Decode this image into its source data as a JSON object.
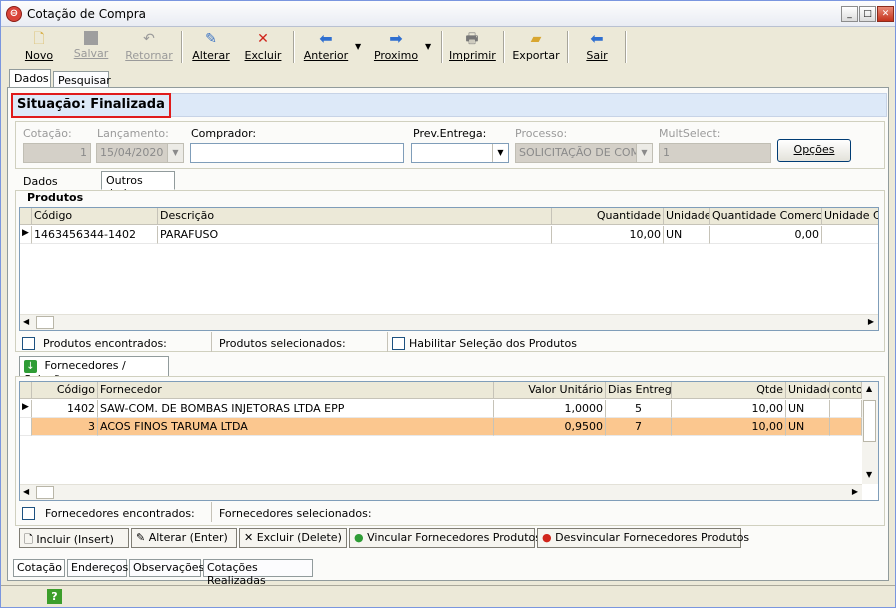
{
  "window": {
    "title": "Cotação de Compra"
  },
  "toolbar": {
    "novo": "Novo",
    "salvar": "Salvar",
    "retornar": "Retornar",
    "alterar": "Alterar",
    "excluir": "Excluir",
    "anterior": "Anterior",
    "proximo": "Proximo",
    "imprimir": "Imprimir",
    "exportar": "Exportar",
    "sair": "Sair"
  },
  "main_tabs": [
    "Dados",
    "Pesquisar"
  ],
  "status": {
    "text": "Situação: Finalizada"
  },
  "header": {
    "cotacao_label": "Cotação:",
    "cotacao_value": "1",
    "lancamento_label": "Lançamento:",
    "lancamento_value": "15/04/2020",
    "comprador_label": "Comprador:",
    "comprador_value": "",
    "prev_entrega_label": "Prev.Entrega:",
    "prev_entrega_value": "",
    "processo_label": "Processo:",
    "processo_value": "SOLICITAÇÃO DE COM",
    "multselect_label": "MultSelect:",
    "multselect_value": "1",
    "opcoes_button": "Opções"
  },
  "sub_tabs": [
    "Dados comuns",
    "Outros dados"
  ],
  "produtos": {
    "title": "Produtos",
    "columns": [
      "Código",
      "Descrição",
      "Quantidade",
      "Unidade",
      "Quantidade Comercial",
      "Unidade Co"
    ],
    "rows": [
      {
        "codigo": "1463456344-1402",
        "descricao": "PARAFUSO",
        "quantidade": "10,00",
        "unidade": "UN",
        "qtd_comercial": "0,00",
        "unidade_co": ""
      }
    ],
    "encontrados_label": "Produtos encontrados:",
    "selecionados_label": "Produtos selecionados:",
    "habilitar_label": "Habilitar Seleção dos Produtos"
  },
  "fornecedores": {
    "tab_label": "Fornecedores / Seleção",
    "columns": [
      "Código",
      "Fornecedor",
      "Valor Unitário",
      "Dias Entrega",
      "Qtde",
      "Unidade",
      "conto"
    ],
    "rows": [
      {
        "codigo": "1402",
        "fornecedor": "SAW-COM. DE BOMBAS INJETORAS LTDA EPP",
        "valor": "1,0000",
        "dias": "5",
        "qtde": "10,00",
        "unidade": "UN"
      },
      {
        "codigo": "3",
        "fornecedor": "ACOS FINOS TARUMA LTDA",
        "valor": "0,9500",
        "dias": "7",
        "qtde": "10,00",
        "unidade": "UN"
      }
    ],
    "encontrados_label": "Fornecedores encontrados:",
    "selecionados_label": "Fornecedores selecionados:"
  },
  "actions": {
    "incluir": "Incluir (Insert)",
    "alterar": "Alterar (Enter)",
    "excluir": "Excluir (Delete)",
    "vincular": "Vincular Fornecedores Produtos",
    "desvincular": "Desvincular Fornecedores Produtos"
  },
  "bottom_tabs": [
    "Cotação",
    "Endereços",
    "Observações",
    "Cotações Realizadas"
  ],
  "colors": {
    "selected_row": "#fbc78f",
    "status_bg": "#dde9f8",
    "status_border": "#e01b1b"
  }
}
